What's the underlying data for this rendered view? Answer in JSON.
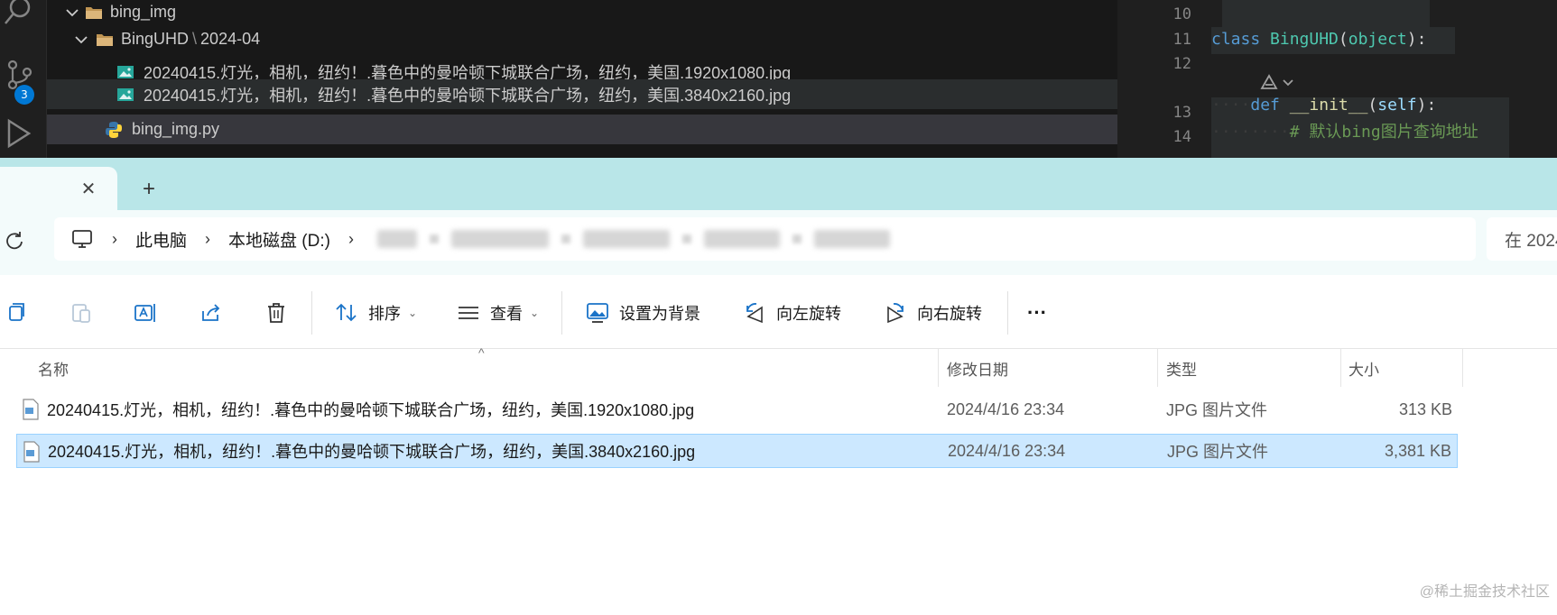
{
  "vscode": {
    "activity": {
      "source_control_badge": "3"
    },
    "explorer": {
      "items": [
        {
          "label": "bing_img",
          "kind": "folder",
          "expanded": true
        },
        {
          "label": "BingUHD",
          "path_suffix": "2024-04",
          "kind": "folder",
          "expanded": true
        },
        {
          "label": "20240415.灯光，相机，纽约！.暮色中的曼哈顿下城联合广场，纽约，美国.1920x1080.jpg",
          "kind": "image"
        },
        {
          "label": "20240415.灯光，相机，纽约！.暮色中的曼哈顿下城联合广场，纽约，美国.3840x2160.jpg",
          "kind": "image"
        },
        {
          "label": "bing_img.py",
          "kind": "python"
        }
      ]
    },
    "editor": {
      "line_numbers": [
        "10",
        "11",
        "12",
        "13",
        "14"
      ],
      "line11": {
        "kw": "class",
        "name": "BingUHD",
        "open": "(",
        "base": "object",
        "close": "):"
      },
      "line13": {
        "kw": "def",
        "name": "__init__",
        "open": "(",
        "param": "self",
        "close": "):"
      },
      "line14": {
        "comment": "# 默认bing图片查询地址"
      }
    }
  },
  "explorer_window": {
    "tab": {
      "close_glyph": "✕",
      "add_glyph": "+"
    },
    "address": {
      "crumbs": [
        "此电脑",
        "本地磁盘 (D:)"
      ],
      "search_placeholder": "在 2024"
    },
    "toolbar": {
      "sort_label": "排序",
      "view_label": "查看",
      "set_background_label": "设置为背景",
      "rotate_left_label": "向左旋转",
      "rotate_right_label": "向右旋转",
      "more_label": "···"
    },
    "columns": {
      "name": "名称",
      "modified": "修改日期",
      "type": "类型",
      "size": "大小"
    },
    "files": [
      {
        "name": "20240415.灯光，相机，纽约！.暮色中的曼哈顿下城联合广场，纽约，美国.1920x1080.jpg",
        "modified": "2024/4/16 23:34",
        "type": "JPG 图片文件",
        "size": "313 KB",
        "selected": false
      },
      {
        "name": "20240415.灯光，相机，纽约！.暮色中的曼哈顿下城联合广场，纽约，美国.3840x2160.jpg",
        "modified": "2024/4/16 23:34",
        "type": "JPG 图片文件",
        "size": "3,381 KB",
        "selected": true
      }
    ]
  },
  "watermark": "@稀土掘金技术社区",
  "colors": {
    "vscode_bg": "#1f1f1f",
    "tab_bar_bg": "#b9e6e8",
    "selection_bg": "#cce8ff",
    "badge_bg": "#0078d4"
  }
}
